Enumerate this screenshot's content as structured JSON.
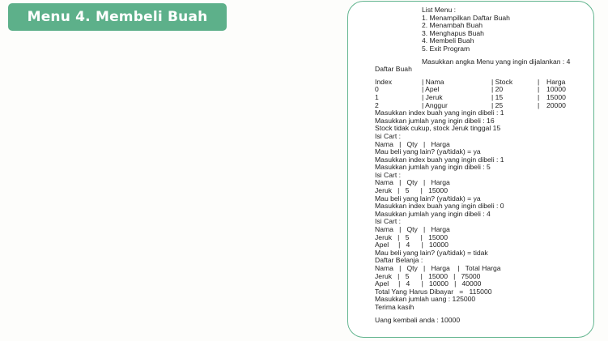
{
  "title": "Menu 4. Membeli Buah",
  "menu": {
    "header": "List Menu :",
    "items": [
      "1. Menampilkan Daftar Buah",
      "2. Menambah Buah",
      "3. Menghapus Buah",
      "4. Membeli Buah",
      "5. Exit Program"
    ],
    "prompt": "Masukkan angka Menu yang ingin dijalankan : 4"
  },
  "fruit_list": {
    "title": "Daftar Buah",
    "headers": [
      "Index",
      "| Nama",
      "| Stock",
      "|",
      "Harga"
    ],
    "rows": [
      [
        "0",
        "| Apel",
        "| 20",
        "|",
        "10000"
      ],
      [
        "1",
        "| Jeruk",
        "| 15",
        "|",
        "15000"
      ],
      [
        "2",
        "| Anggur",
        "| 25",
        "|",
        "20000"
      ]
    ]
  },
  "session": {
    "a1": "Masukkan index buah yang ingin dibeli : 1",
    "a2": "Masukkan jumlah yang ingin dibeli : 16",
    "a3": "Stock tidak cukup, stock Jeruk tinggal 15",
    "a4": "Isi Cart :",
    "a5": "Nama   |   Qty   |   Harga",
    "a6": "Mau beli yang lain? (ya/tidak) = ya",
    "b1": "Masukkan index buah yang ingin dibeli : 1",
    "b2": "Masukkan jumlah yang ingin dibeli : 5",
    "b3": "Isi Cart :",
    "b4": "Nama   |   Qty   |   Harga",
    "b5": "Jeruk   |   5      |   15000",
    "b6": "Mau beli yang lain? (ya/tidak) = ya",
    "c1": "Masukkan index buah yang ingin dibeli : 0",
    "c2": "Masukkan jumlah yang ingin dibeli : 4",
    "c3": "Isi Cart :",
    "c4": "Nama   |   Qty   |   Harga",
    "c5": "Jeruk   |   5      |   15000",
    "c6": "Apel     |   4      |   10000",
    "c7": "Mau beli yang lain? (ya/tidak) = tidak",
    "d1": "Daftar Belanja :",
    "d2": "Nama   |   Qty   |   Harga    |   Total Harga",
    "d3": "Jeruk   |   5      |   15000   |   75000",
    "d4": "Apel     |   4      |   10000   |   40000",
    "d5": "Total Yang Harus Dibayar   =   115000",
    "d6": "Masukkan jumlah uang : 125000",
    "d7": "Terima kasih",
    "d8": "Uang kembali anda : 10000"
  },
  "colors": {
    "accent": "#5db08a",
    "frame_border": "#63b58f",
    "text": "#222222"
  }
}
